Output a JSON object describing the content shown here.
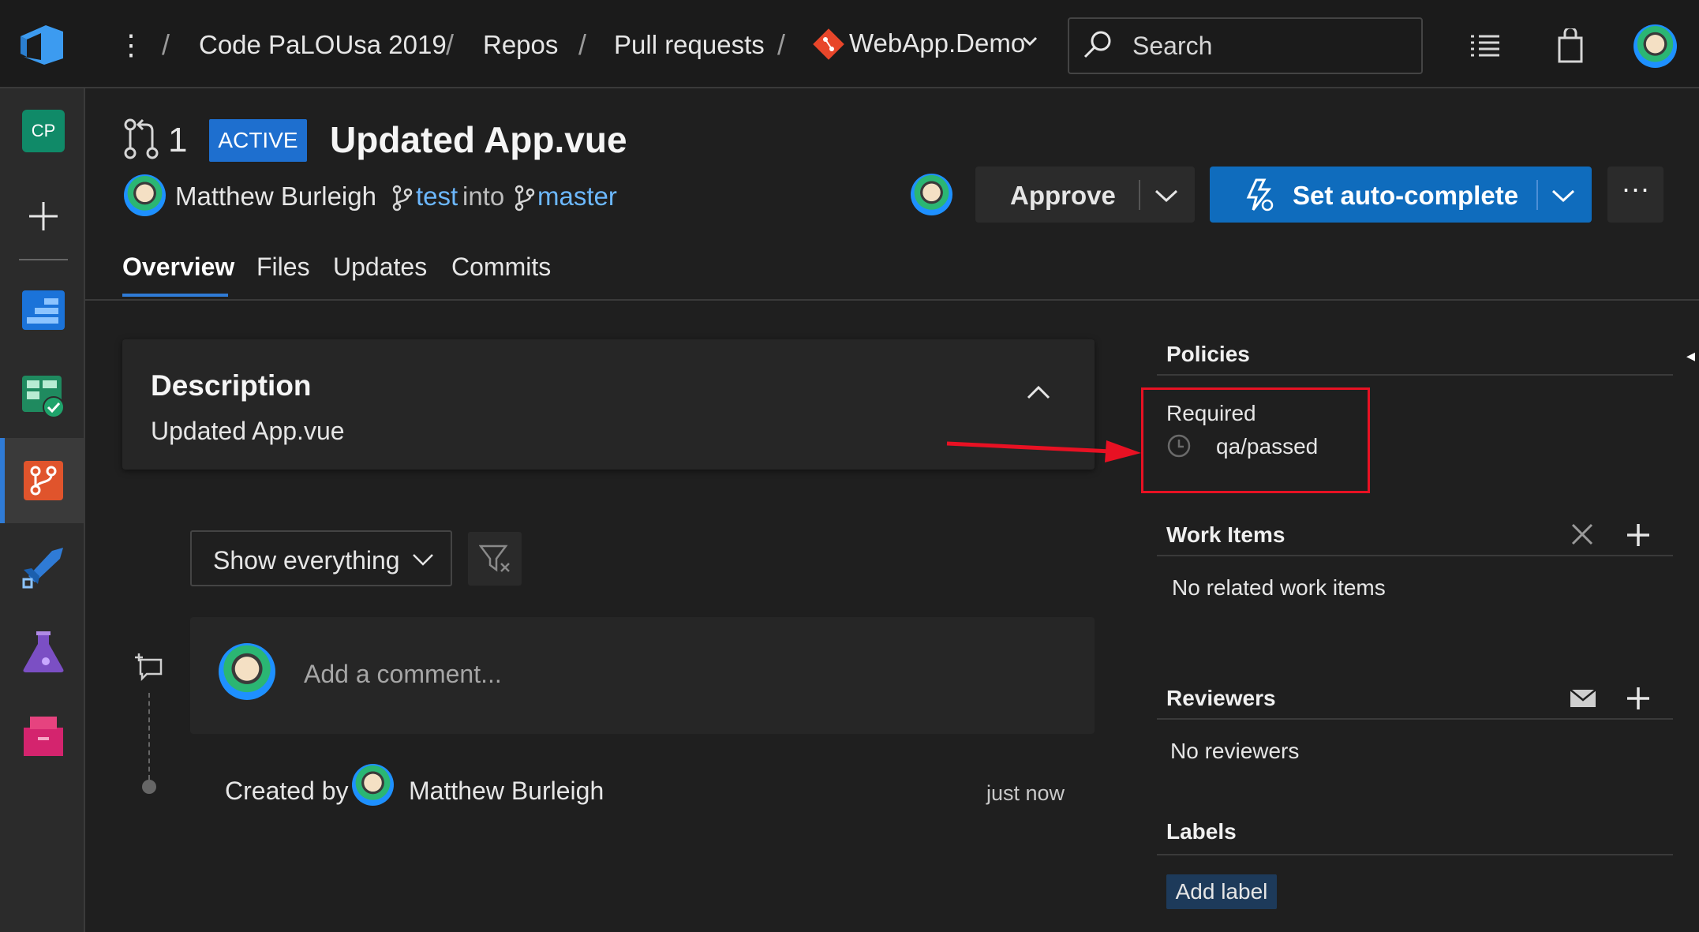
{
  "breadcrumbs": {
    "org": "Code PaLOUsa 2019",
    "repos": "Repos",
    "pull_requests": "Pull requests",
    "repo": "WebApp.Demo"
  },
  "search": {
    "placeholder": "Search"
  },
  "left_rail": {
    "project_initials": "CP"
  },
  "pr": {
    "id": "1",
    "status": "ACTIVE",
    "title": "Updated App.vue",
    "author": "Matthew Burleigh",
    "source_branch": "test",
    "into": "into",
    "target_branch": "master"
  },
  "actions": {
    "approve": "Approve",
    "autocomplete": "Set auto-complete",
    "more": "···"
  },
  "tabs": [
    "Overview",
    "Files",
    "Updates",
    "Commits"
  ],
  "description": {
    "title": "Description",
    "body": "Updated App.vue"
  },
  "activity": {
    "filter_label": "Show everything",
    "comment_placeholder": "Add a comment...",
    "created_by": "Created by",
    "created_name": "Matthew Burleigh",
    "created_time": "just now"
  },
  "sidebar": {
    "policies_title": "Policies",
    "required_label": "Required",
    "policy_name": "qa/passed",
    "work_items_title": "Work Items",
    "work_items_empty": "No related work items",
    "reviewers_title": "Reviewers",
    "reviewers_empty": "No reviewers",
    "labels_title": "Labels",
    "add_label": "Add label"
  },
  "colors": {
    "accent": "#0f6cbd",
    "link": "#6cb8ff",
    "annotation": "#e81123"
  }
}
